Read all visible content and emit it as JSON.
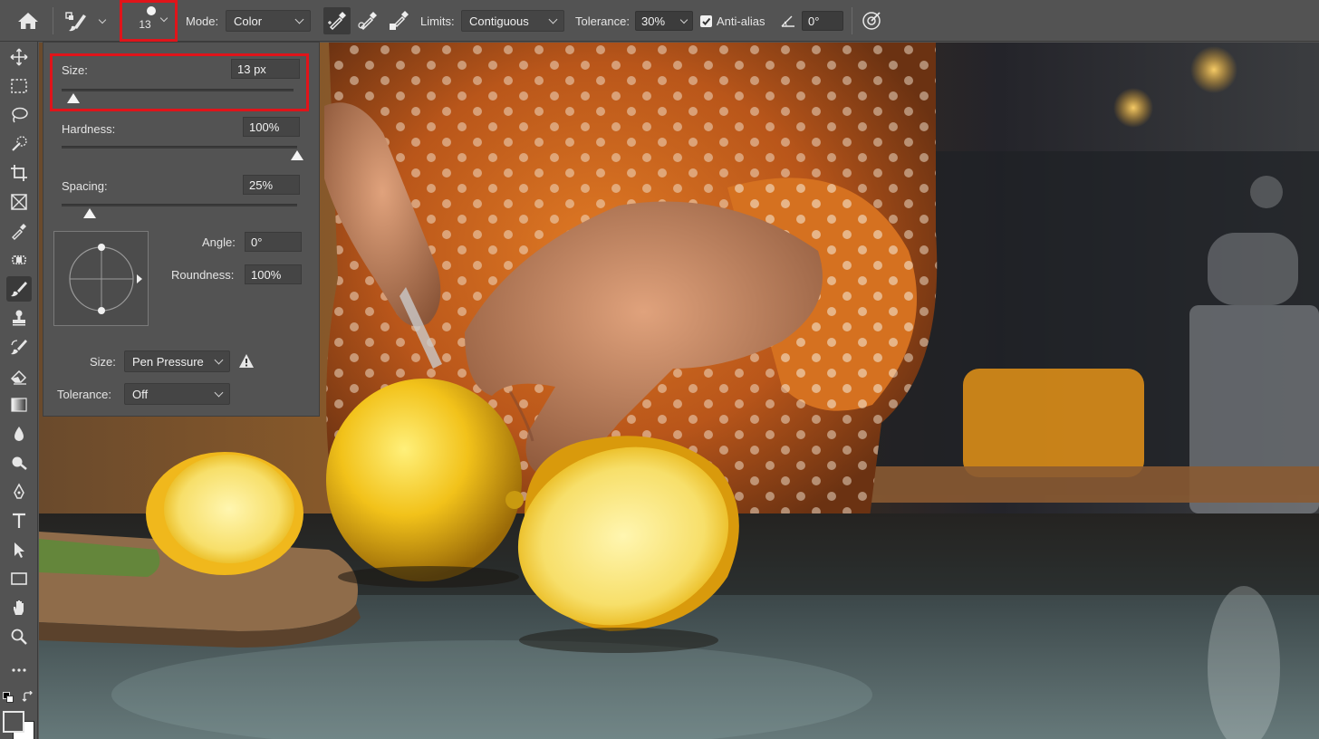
{
  "options_bar": {
    "brush_size": "13",
    "mode_label": "Mode:",
    "mode_value": "Color",
    "limits_label": "Limits:",
    "limits_value": "Contiguous",
    "tolerance_label": "Tolerance:",
    "tolerance_value": "30%",
    "antialias_label": "Anti-alias",
    "antialias_checked": true,
    "angle_value": "0°"
  },
  "brush_panel": {
    "size_label": "Size:",
    "size_value": "13 px",
    "size_fraction": 0.05,
    "hardness_label": "Hardness:",
    "hardness_value": "100%",
    "hardness_fraction": 1.0,
    "spacing_label": "Spacing:",
    "spacing_value": "25%",
    "spacing_fraction": 0.12,
    "angle_label": "Angle:",
    "angle_value": "0°",
    "roundness_label": "Roundness:",
    "roundness_value": "100%",
    "dynamics_size_label": "Size:",
    "dynamics_size_value": "Pen Pressure",
    "dynamics_tolerance_label": "Tolerance:",
    "dynamics_tolerance_value": "Off"
  },
  "toolbar": {
    "tools": [
      "move-tool",
      "marquee-tool",
      "lasso-tool",
      "quick-selection-tool",
      "crop-tool",
      "frame-tool",
      "eyedropper-tool",
      "healing-brush-tool",
      "brush-tool",
      "clone-stamp-tool",
      "history-brush-tool",
      "eraser-tool",
      "gradient-tool",
      "blur-tool",
      "dodge-tool",
      "pen-tool",
      "type-tool",
      "path-selection-tool",
      "rectangle-tool",
      "hand-tool",
      "zoom-tool",
      "more-tools"
    ],
    "active_tool": "brush-tool"
  },
  "colors": {
    "accent_highlight": "#e0141a",
    "foreground": "#000000",
    "background": "#ffffff"
  }
}
